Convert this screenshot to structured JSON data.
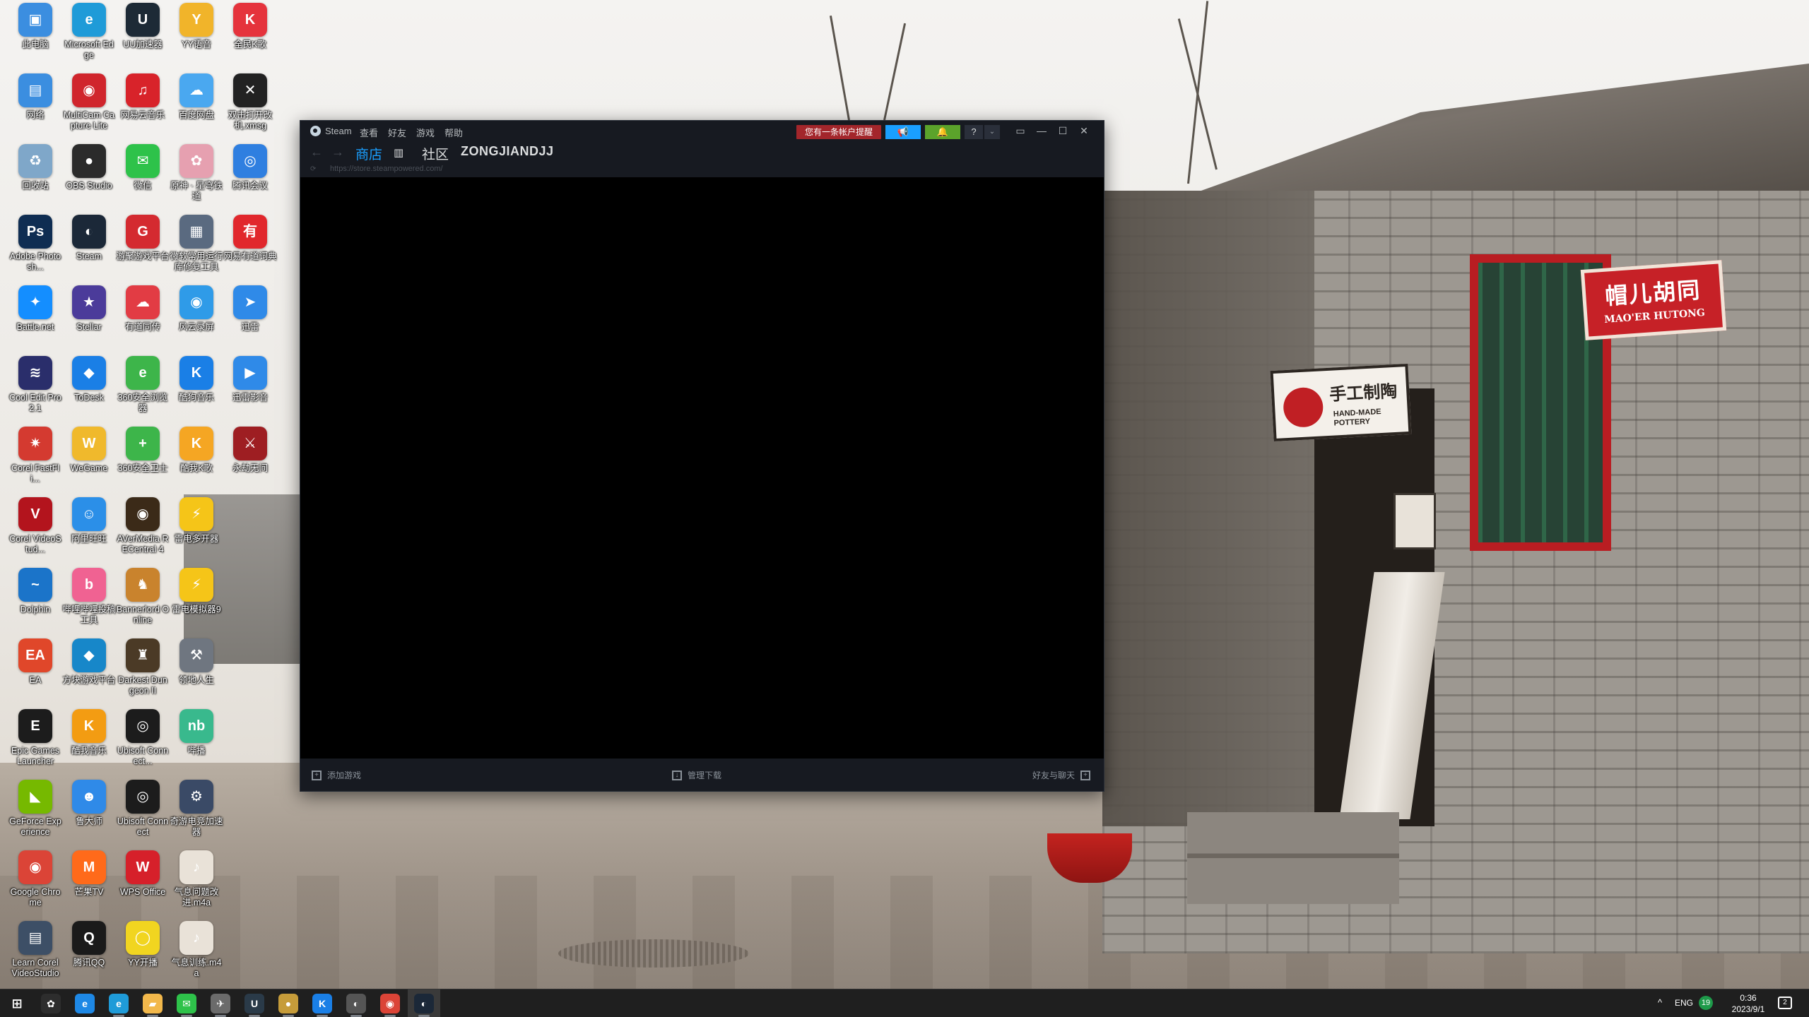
{
  "desktop": {
    "icons": [
      {
        "label": "此电脑",
        "glyph": "▣",
        "color": "#3b8ee0"
      },
      {
        "label": "Microsoft Edge",
        "glyph": "e",
        "color": "#1f9bd8"
      },
      {
        "label": "UU加速器",
        "glyph": "U",
        "color": "#1d2a36"
      },
      {
        "label": "YY语音",
        "glyph": "Y",
        "color": "#f1b42a"
      },
      {
        "label": "全民K歌",
        "glyph": "K",
        "color": "#e5333c"
      },
      {
        "label": "网络",
        "glyph": "▤",
        "color": "#3b8ee0"
      },
      {
        "label": "MultiCam Capture Lite",
        "glyph": "◉",
        "color": "#d0252c"
      },
      {
        "label": "网易云音乐",
        "glyph": "♫",
        "color": "#d8232a"
      },
      {
        "label": "百度网盘",
        "glyph": "☁",
        "color": "#4aa8f0"
      },
      {
        "label": "双击打开改机.xmsg",
        "glyph": "✕",
        "color": "#222222"
      },
      {
        "label": "回收站",
        "glyph": "♻",
        "color": "#7fa7c9"
      },
      {
        "label": "OBS Studio",
        "glyph": "●",
        "color": "#2b2b2b"
      },
      {
        "label": "微信",
        "glyph": "✉",
        "color": "#2ec24a"
      },
      {
        "label": "原神 · 星穹铁道",
        "glyph": "✿",
        "color": "#e6a0b0"
      },
      {
        "label": "腾讯会议",
        "glyph": "◎",
        "color": "#2f7fe0"
      },
      {
        "label": "Adobe Photosh...",
        "glyph": "Ps",
        "color": "#0f2d52"
      },
      {
        "label": "Steam",
        "glyph": "◐",
        "color": "#1b2838"
      },
      {
        "label": "游聚游戏平台",
        "glyph": "G",
        "color": "#d42a30"
      },
      {
        "label": "微软常用运行库修复工具",
        "glyph": "▦",
        "color": "#5a6a80"
      },
      {
        "label": "网易有道词典",
        "glyph": "有",
        "color": "#e1272c"
      },
      {
        "label": "Battle.net",
        "glyph": "✦",
        "color": "#148eff"
      },
      {
        "label": "Stellar",
        "glyph": "★",
        "color": "#4b3b9a"
      },
      {
        "label": "有道同传",
        "glyph": "☁",
        "color": "#e23c44"
      },
      {
        "label": "风云录屏",
        "glyph": "◉",
        "color": "#2f9be8"
      },
      {
        "label": "迅雷",
        "glyph": "➤",
        "color": "#2f8ae8"
      },
      {
        "label": "Cool Edit Pro 2.1",
        "glyph": "≋",
        "color": "#2a2e6b"
      },
      {
        "label": "ToDesk",
        "glyph": "◆",
        "color": "#1a7fe6"
      },
      {
        "label": "360安全浏览器",
        "glyph": "e",
        "color": "#3db54a"
      },
      {
        "label": "酷狗音乐",
        "glyph": "K",
        "color": "#1a7fe6"
      },
      {
        "label": "迅雷影音",
        "glyph": "▶",
        "color": "#2f8ae8"
      },
      {
        "label": "Corel FastFli...",
        "glyph": "✷",
        "color": "#d43a30"
      },
      {
        "label": "WeGame",
        "glyph": "W",
        "color": "#f0b92c"
      },
      {
        "label": "360安全卫士",
        "glyph": "+",
        "color": "#3db54a"
      },
      {
        "label": "酷我K歌",
        "glyph": "K",
        "color": "#f5a623"
      },
      {
        "label": "永劫无间",
        "glyph": "⚔",
        "color": "#9e1e22"
      },
      {
        "label": "Corel VideoStud...",
        "glyph": "V",
        "color": "#b3141d"
      },
      {
        "label": "阿里旺旺",
        "glyph": "☺",
        "color": "#2b8fe8"
      },
      {
        "label": "AVerMedia RECentral 4",
        "glyph": "◉",
        "color": "#3b2a18"
      },
      {
        "label": "雷电多开器",
        "glyph": "⚡",
        "color": "#f5c518"
      },
      {
        "label": "Dolphin",
        "glyph": "~",
        "color": "#1b74c9"
      },
      {
        "label": "哔哩哔哩投稿工具",
        "glyph": "b",
        "color": "#f06292"
      },
      {
        "label": "Bannerlord Online",
        "glyph": "♞",
        "color": "#c9832d"
      },
      {
        "label": "雷电模拟器9",
        "glyph": "⚡",
        "color": "#f5c518"
      },
      {
        "label": "EA",
        "glyph": "EA",
        "color": "#e0472a"
      },
      {
        "label": "方块游戏平台",
        "glyph": "◆",
        "color": "#1787c9"
      },
      {
        "label": "Darkest Dungeon II",
        "glyph": "♜",
        "color": "#4b3a26"
      },
      {
        "label": "领地人生",
        "glyph": "⚒",
        "color": "#6f7680"
      },
      {
        "label": "Epic Games Launcher",
        "glyph": "E",
        "color": "#1c1c1c"
      },
      {
        "label": "酷我音乐",
        "glyph": "K",
        "color": "#f39c12"
      },
      {
        "label": "Ubisoft Connect...",
        "glyph": "◎",
        "color": "#1c1c1c"
      },
      {
        "label": "哔播",
        "glyph": "nb",
        "color": "#39b98d"
      },
      {
        "label": "GeForce Experience",
        "glyph": "◣",
        "color": "#76b900"
      },
      {
        "label": "鲁大师",
        "glyph": "☻",
        "color": "#2f8ae8"
      },
      {
        "label": "Ubisoft Connect",
        "glyph": "◎",
        "color": "#1c1c1c"
      },
      {
        "label": "奇游电竞加速器",
        "glyph": "⚙",
        "color": "#3a4a66"
      },
      {
        "label": "Google Chrome",
        "glyph": "◉",
        "color": "#db4437"
      },
      {
        "label": "芒果TV",
        "glyph": "M",
        "color": "#ff6a1a"
      },
      {
        "label": "WPS Office",
        "glyph": "W",
        "color": "#d6202a"
      },
      {
        "label": "气息问题改进.m4a",
        "glyph": "♪",
        "color": "#e9e2d8"
      },
      {
        "label": "Learn Corel VideoStudio",
        "glyph": "▤",
        "color": "#3d4f66"
      },
      {
        "label": "腾讯QQ",
        "glyph": "Q",
        "color": "#1a1a1a"
      },
      {
        "label": "YY开播",
        "glyph": "◯",
        "color": "#f1d520"
      },
      {
        "label": "气息训练.m4a",
        "glyph": "♪",
        "color": "#e9e2d8"
      }
    ]
  },
  "steam": {
    "titlebar": {
      "app_name": "Steam",
      "menus": [
        "查看",
        "好友",
        "游戏",
        "帮助"
      ],
      "alert_label": "您有一条帐户提醒",
      "announce_icon": "megaphone-icon",
      "notif_icon": "bell-icon",
      "help_label": "?",
      "caret": "⌄",
      "controls": {
        "screen": "▭",
        "minimize": "—",
        "maximize": "☐",
        "close": "✕"
      }
    },
    "nav": {
      "back": "←",
      "forward": "→",
      "tabs": [
        "商店",
        "社区"
      ],
      "library_icon": "▥",
      "username": "ZONGJIANDJJ"
    },
    "url": "https://store.steampowered.com/",
    "footer": {
      "add_game": "添加游戏",
      "manage_downloads": "管理下载",
      "friends_chat": "好友与聊天"
    },
    "colors": {
      "accent": "#1a9fff",
      "alert": "#a3262b",
      "notif": "#5ba32b",
      "bg": "#171a21"
    }
  },
  "taskbar": {
    "start_icon": "windows-icon",
    "apps": [
      {
        "name": "widgets",
        "glyph": "✿",
        "color": "#2d2d2d"
      },
      {
        "name": "ie",
        "glyph": "e",
        "color": "#1e88e5"
      },
      {
        "name": "edge",
        "glyph": "e",
        "color": "#1f9bd8"
      },
      {
        "name": "explorer",
        "glyph": "▰",
        "color": "#f2b84b"
      },
      {
        "name": "wechat",
        "glyph": "✉",
        "color": "#2ec24a"
      },
      {
        "name": "clash",
        "glyph": "✈",
        "color": "#6b6b6b"
      },
      {
        "name": "uu",
        "glyph": "U",
        "color": "#2a3a48"
      },
      {
        "name": "obs",
        "glyph": "●",
        "color": "#c69c3a"
      },
      {
        "name": "kugou",
        "glyph": "K",
        "color": "#1a7fe6"
      },
      {
        "name": "obs-studio",
        "glyph": "◐",
        "color": "#555555"
      },
      {
        "name": "chrome",
        "glyph": "◉",
        "color": "#db4437"
      },
      {
        "name": "steam",
        "glyph": "◐",
        "color": "#1b2838"
      }
    ],
    "tray": {
      "chevron": "^",
      "lang": "ENG",
      "badge": "19",
      "time": "0:36",
      "date": "2023/9/1",
      "notifications": "2"
    }
  }
}
